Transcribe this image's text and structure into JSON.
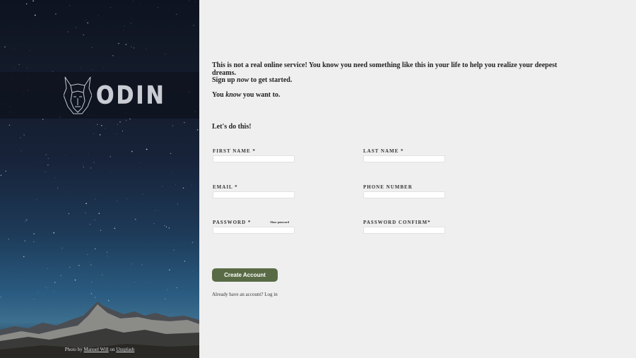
{
  "brand": {
    "name": "ODIN",
    "logo_icon": "viking-helmet-icon"
  },
  "hero": {
    "credit_prefix": "Photo by ",
    "credit_author": "Manuel Will",
    "credit_middle": " on ",
    "credit_site": "Unsplash"
  },
  "intro": {
    "line1": "This is not a real online service! You know you need something like this in your life to help you realize your deepest dreams.",
    "line2_pre": "Sign up ",
    "line2_em": "now",
    "line2_post": " to get started.",
    "line3_pre": "You ",
    "line3_em": "know",
    "line3_post": " you want to."
  },
  "form": {
    "heading": "Let's do this!",
    "first_name": {
      "label": "First Name *",
      "value": ""
    },
    "last_name": {
      "label": "Last Name *",
      "value": ""
    },
    "email": {
      "label": "Email *",
      "value": ""
    },
    "phone": {
      "label": "Phone Number",
      "value": ""
    },
    "password": {
      "label": "Password *",
      "value": "",
      "toggle": "Show password"
    },
    "password_confirm": {
      "label": "Password Confirm*",
      "value": ""
    },
    "submit_label": "Create Account",
    "login_prompt": "Already have an account? ",
    "login_link": "Log in"
  },
  "colors": {
    "accent": "#596b45",
    "panel_bg": "#efefef"
  }
}
